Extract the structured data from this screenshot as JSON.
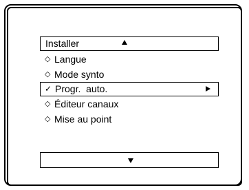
{
  "menu": {
    "header": {
      "title": "Installer",
      "scroll_up_icon": "triangle-up-icon"
    },
    "items": [
      {
        "bullet": "◇",
        "label": "Langue",
        "selected": false
      },
      {
        "bullet": "◇",
        "label": "Mode synto",
        "selected": false
      },
      {
        "bullet": "✓",
        "label": "Progr.  auto.",
        "selected": true,
        "submenu_icon": "triangle-right-icon"
      },
      {
        "bullet": "◇",
        "label": "Éditeur canaux",
        "selected": false
      },
      {
        "bullet": "◇",
        "label": "Mise au point",
        "selected": false
      }
    ],
    "footer": {
      "scroll_down_icon": "triangle-down-icon"
    }
  }
}
